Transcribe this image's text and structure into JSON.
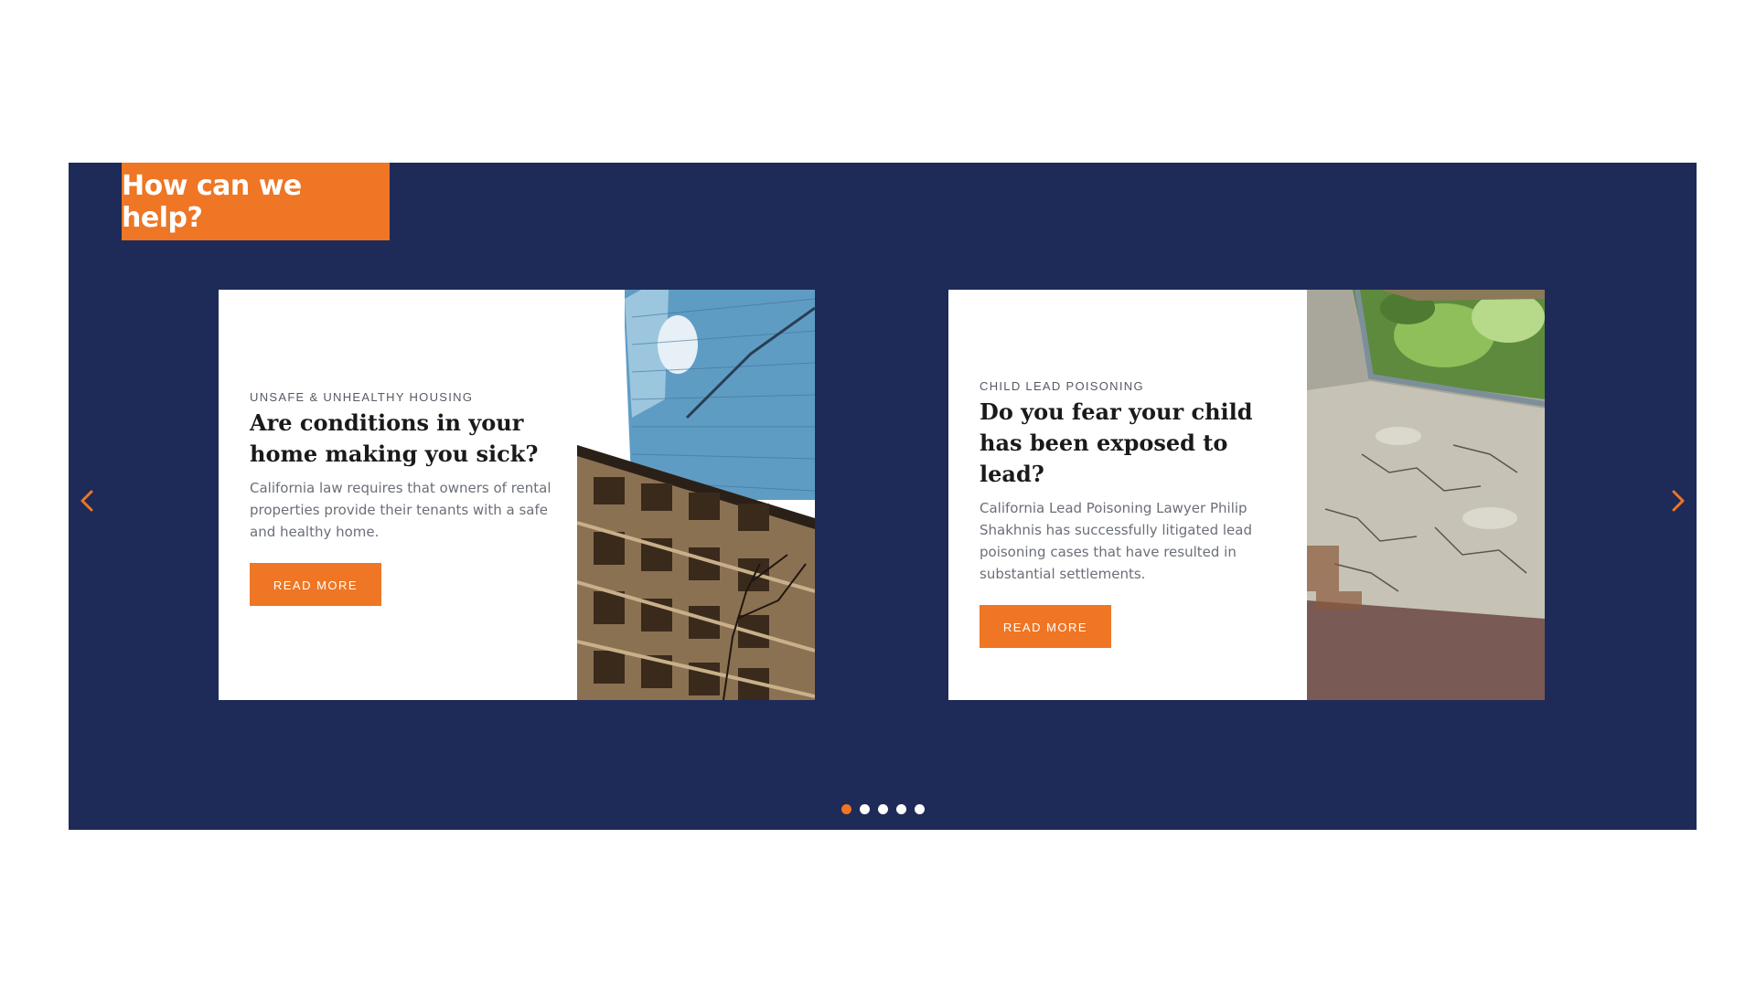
{
  "section": {
    "heading": "How can we help?",
    "colors": {
      "background": "#1e2b58",
      "accent": "#ee7624"
    }
  },
  "cards": [
    {
      "eyebrow": "UNSAFE & UNHEALTHY HOUSING",
      "title": "Are conditions in your home making you sick?",
      "body": "California law requires that owners of rental properties provide their tenants with a safe and healthy home.",
      "button": "READ MORE",
      "image": "apartment-building-photo"
    },
    {
      "eyebrow": "CHILD LEAD POISONING",
      "title": "Do you fear your child has been exposed to lead?",
      "body": "California Lead Poisoning Lawyer Philip Shakhnis has successfully litigated lead poisoning cases that have resulted in substantial settlements.",
      "button": "READ MORE",
      "image": "peeling-paint-windowsill-photo"
    }
  ],
  "carousel": {
    "prev_icon": "chevron-left-icon",
    "next_icon": "chevron-right-icon",
    "dot_count": 5,
    "active_index": 0
  }
}
